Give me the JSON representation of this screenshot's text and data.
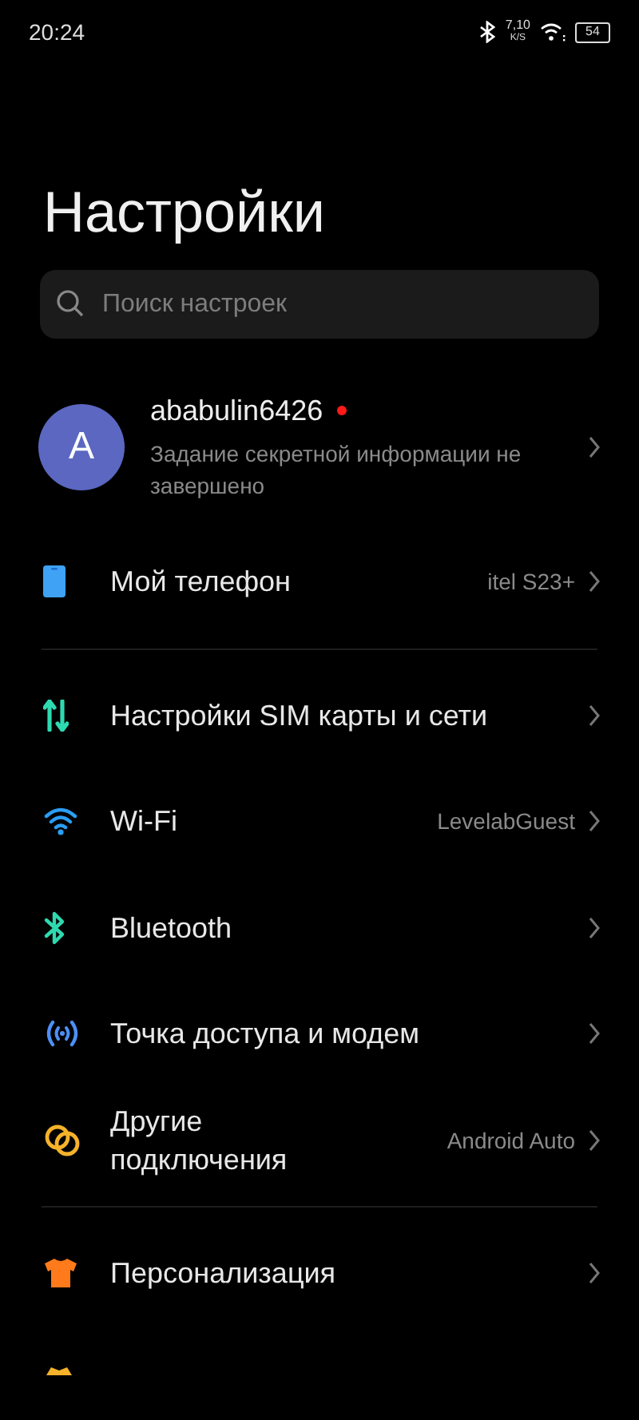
{
  "status_bar": {
    "time": "20:24",
    "speed_value": "7,10",
    "speed_unit": "K/S",
    "battery": "54"
  },
  "title": "Настройки",
  "search": {
    "placeholder": "Поиск настроек"
  },
  "account": {
    "initial": "A",
    "name": "ababulin6426",
    "alert": true,
    "subtitle": "Задание секретной информации не завершено"
  },
  "groups": [
    [
      {
        "kind": "phone",
        "label": "Мой телефон",
        "value": "itel S23+"
      }
    ],
    [
      {
        "kind": "sim",
        "label": "Настройки SIM карты и сети"
      },
      {
        "kind": "wifi",
        "label": "Wi-Fi",
        "value": "LevelabGuest"
      },
      {
        "kind": "bluetooth",
        "label": "Bluetooth"
      },
      {
        "kind": "hotspot",
        "label": "Точка доступа и модем"
      },
      {
        "kind": "links",
        "label": "Другие подключения",
        "value": "Android Auto"
      }
    ],
    [
      {
        "kind": "shirt",
        "label": "Персонализация"
      },
      {
        "kind": "partial"
      }
    ]
  ]
}
